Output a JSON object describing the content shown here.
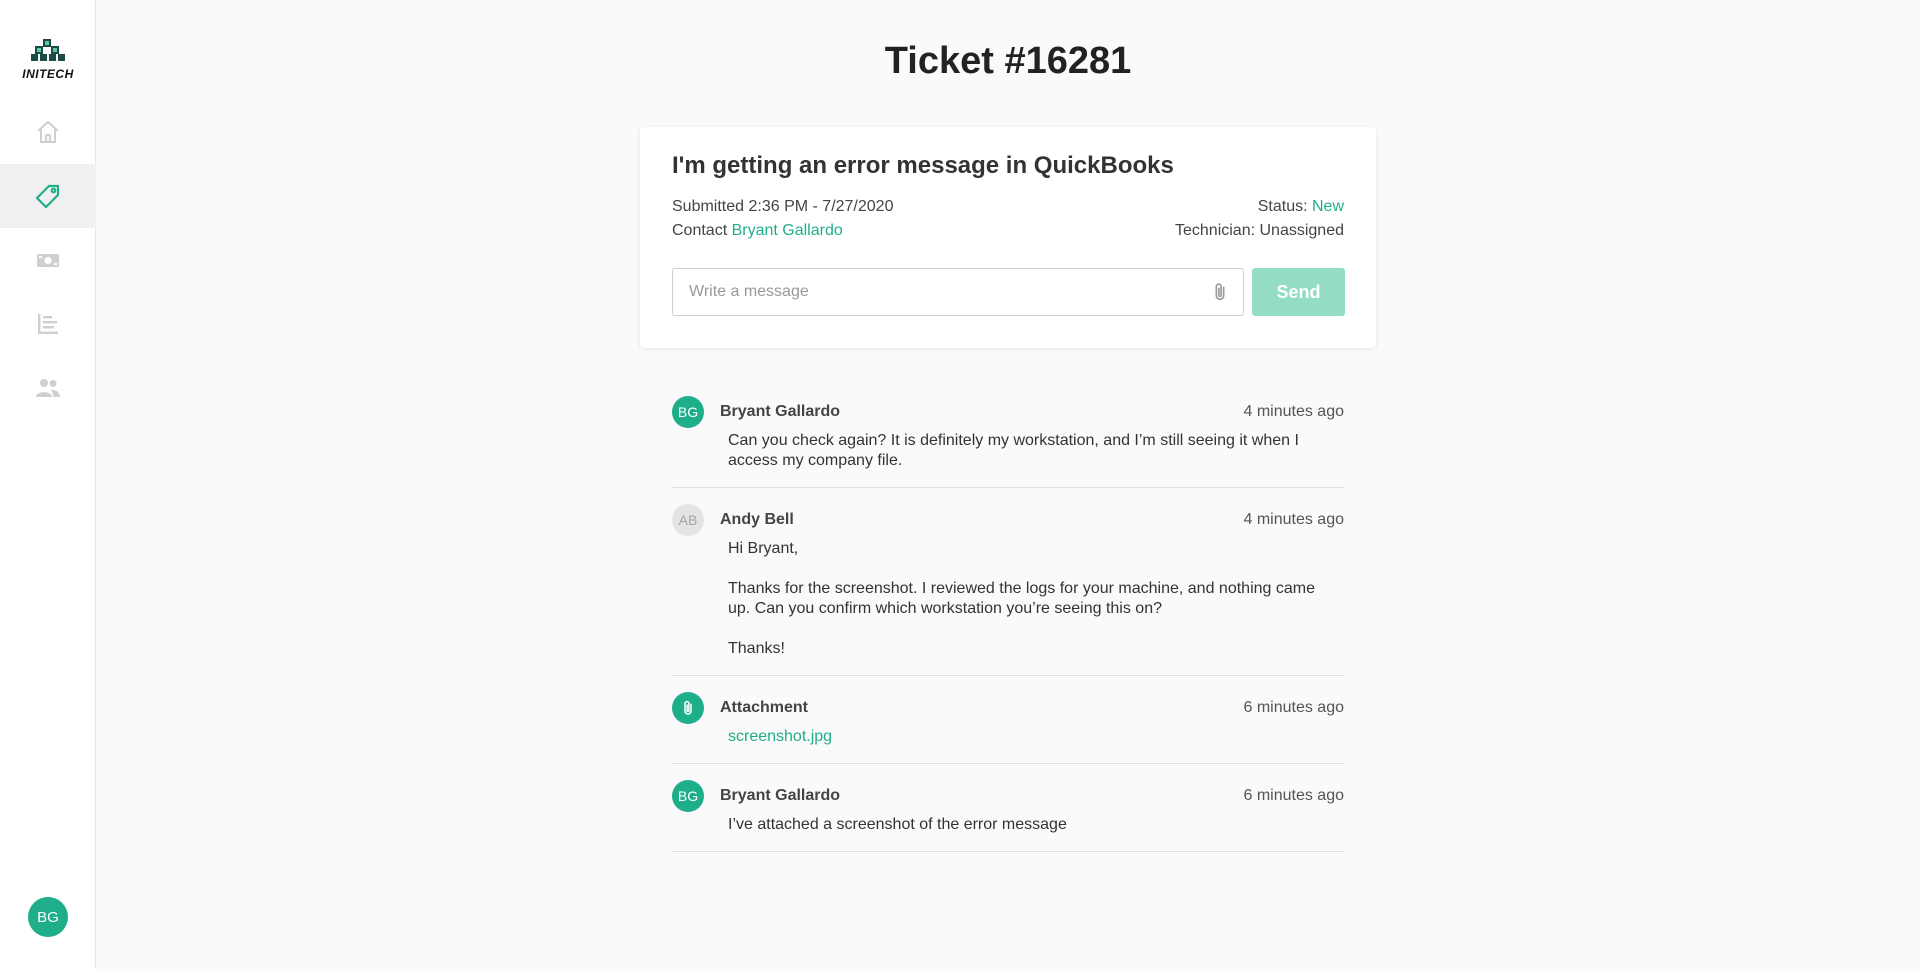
{
  "app": {
    "logo_text": "INITECH",
    "accent_color": "#1fae8a"
  },
  "sidebar": {
    "items": [
      {
        "name": "home",
        "icon": "home-icon",
        "active": false
      },
      {
        "name": "tickets",
        "icon": "tag-icon",
        "active": true
      },
      {
        "name": "billing",
        "icon": "money-icon",
        "active": false
      },
      {
        "name": "reports",
        "icon": "bar-chart-icon",
        "active": false
      },
      {
        "name": "users",
        "icon": "people-icon",
        "active": false
      }
    ],
    "user_initials": "BG"
  },
  "page": {
    "title": "Ticket #16281"
  },
  "ticket": {
    "subject": "I'm getting an error message in QuickBooks",
    "submitted_label": "Submitted 2:36 PM - 7/27/2020",
    "contact_label": "Contact ",
    "contact_name": "Bryant Gallardo",
    "status_label": "Status: ",
    "status_value": "New",
    "technician_label": "Technician: Unassigned"
  },
  "composer": {
    "placeholder": "Write a message",
    "value": "",
    "send_label": "Send"
  },
  "messages": [
    {
      "author": "Bryant Gallardo",
      "initials": "BG",
      "time": "4 minutes ago",
      "paragraphs": [
        "Can you check again? It is definitely my workstation, and I’m still seeing it when I access my company file."
      ]
    },
    {
      "author": "Andy Bell",
      "initials": "AB",
      "time": "4 minutes ago",
      "paragraphs": [
        "Hi Bryant,",
        "Thanks for the screenshot. I reviewed the logs for your machine, and nothing came up. Can you confirm which workstation you’re seeing this on?",
        "Thanks!"
      ]
    },
    {
      "author": "Attachment",
      "icon": "paperclip-icon",
      "time": "6 minutes ago",
      "file": "screenshot.jpg"
    },
    {
      "author": "Bryant Gallardo",
      "initials": "BG",
      "time": "6 minutes ago",
      "paragraphs": [
        "I’ve attached a screenshot of the error message"
      ]
    }
  ]
}
